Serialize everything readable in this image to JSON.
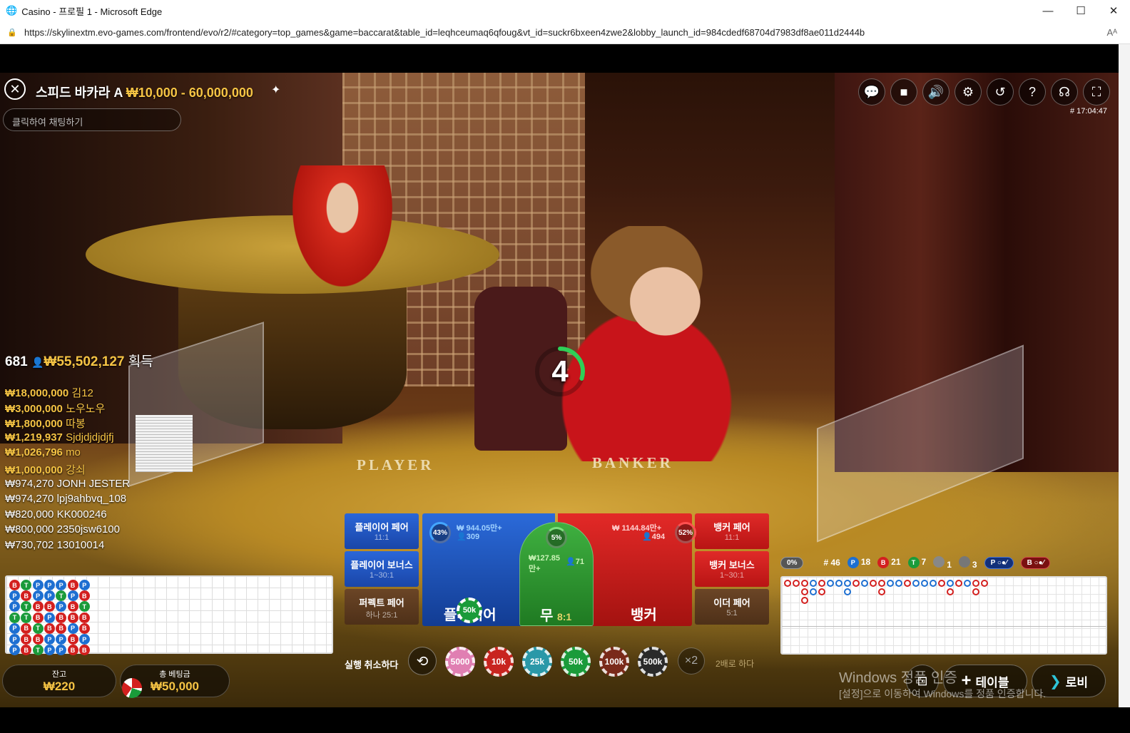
{
  "browser": {
    "title": "Casino - 프로필 1 - Microsoft Edge",
    "url": "https://skylinextm.evo-games.com/frontend/evo/r2/#category=top_games&game=baccarat&table_id=leqhceumaq6qfoug&vt_id=suckr6bxeen4zwe2&lobby_launch_id=984cdedf68704d7983df8ae011d2444b",
    "controls": {
      "minimize": "—",
      "maximize": "☐",
      "close": "✕"
    },
    "read_aloud": "Aᴬ"
  },
  "header": {
    "table_name": "스피드 바카라 A",
    "limits": "₩10,000 - 60,000,000",
    "chat_placeholder": "클릭하여 채팅하기",
    "game_id": "# 17:04:47",
    "icons": [
      "chat-icon",
      "video-icon",
      "volume-icon",
      "settings-icon",
      "history-icon",
      "help-icon",
      "headset-icon",
      "fullscreen-icon"
    ],
    "icon_glyphs": [
      "💬",
      "■",
      "🔊",
      "⚙",
      "↺",
      "?",
      "☊",
      "⛶"
    ]
  },
  "table_labels": {
    "player": "PLAYER",
    "banker": "BANKER"
  },
  "countdown": {
    "value": "4",
    "fraction_remaining": 0.3
  },
  "winners": {
    "count": "681",
    "total": "₩55,502,127",
    "label": "획득",
    "list": [
      {
        "amount": "₩18,000,000",
        "name": "김12"
      },
      {
        "amount": "₩3,000,000",
        "name": "노우노우"
      },
      {
        "amount": "₩1,800,000",
        "name": "따봉"
      },
      {
        "amount": "₩1,219,937",
        "name": "Sjdjdjdjdjfj"
      },
      {
        "amount": "₩1,026,796",
        "name": "mo"
      },
      {
        "amount": "₩1,000,000",
        "name": "강쇠"
      },
      {
        "amount": "₩974,270",
        "name": "JONH JESTER"
      },
      {
        "amount": "₩974,270",
        "name": "lpj9ahbvq_108"
      },
      {
        "amount": "₩820,000",
        "name": "KK000246"
      },
      {
        "amount": "₩800,000",
        "name": "2350jsw6100"
      },
      {
        "amount": "₩730,702",
        "name": "13010014"
      }
    ]
  },
  "bead_road": [
    [
      "B",
      "P",
      "P",
      "T",
      "P",
      "P",
      "P"
    ],
    [
      "T",
      "B",
      "T",
      "T",
      "B",
      "B",
      "B"
    ],
    [
      "P",
      "P",
      "B",
      "B",
      "T",
      "B",
      "T"
    ],
    [
      "P",
      "P",
      "B",
      "P",
      "B",
      "P",
      "P"
    ],
    [
      "P",
      "T",
      "P",
      "B",
      "B",
      "P",
      "P"
    ],
    [
      "B",
      "P",
      "B",
      "B",
      "P",
      "B",
      "B"
    ],
    [
      "P",
      "B",
      "T",
      "B",
      "B",
      "P",
      "B"
    ]
  ],
  "balance": {
    "label": "잔고",
    "value": "₩220"
  },
  "total_bet": {
    "label": "총 베팅금",
    "value": "₩50,000"
  },
  "bets": {
    "player_pair": {
      "label": "플레이어 페어",
      "odds": "11:1"
    },
    "player_bonus": {
      "label": "플레이어 보너스",
      "odds": "1~30:1"
    },
    "perfect_pair": {
      "label": "퍼펙트 페어",
      "odds": "하나 25:1"
    },
    "banker_pair": {
      "label": "뱅커 페어",
      "odds": "11:1"
    },
    "banker_bonus": {
      "label": "뱅커 보너스",
      "odds": "1~30:1"
    },
    "either_pair": {
      "label": "이더 페어",
      "odds": "5:1"
    },
    "player": {
      "label": "플레이어",
      "amount": "₩ 944.05만+",
      "players": "309",
      "percent": "43%",
      "chip": "50k"
    },
    "tie": {
      "label": "무",
      "odds": "8:1",
      "amount": "₩127.85만+",
      "players": "71",
      "percent": "5%"
    },
    "banker": {
      "label": "뱅커",
      "amount": "₩ 1144.84만+",
      "players": "494",
      "percent": "52%"
    }
  },
  "chip_tray": {
    "undo_label": "실행 취소하다",
    "undo_glyph": "⟲",
    "chips": [
      {
        "label": "5000",
        "color": "#e07fb2"
      },
      {
        "label": "10k",
        "color": "#c8241f"
      },
      {
        "label": "25k",
        "color": "#2a98a8"
      },
      {
        "label": "50k",
        "color": "#1a9b3a"
      },
      {
        "label": "100k",
        "color": "#7a2a1a"
      },
      {
        "label": "500k",
        "color": "#2a2a2a"
      }
    ],
    "double_glyph": "×2",
    "double_label": "2배로 하다"
  },
  "road_stats": {
    "progress": "0%",
    "round": "# 46",
    "p_count": "18",
    "b_count": "21",
    "t_count": "7",
    "pp_count": "1",
    "bp_count": "3",
    "p_badge": "P",
    "b_badge": "B",
    "t_badge": "T",
    "p_predict": "P ○●⁄",
    "b_predict": "B ○●⁄"
  },
  "bottom_buttons": {
    "table_glyph": "+",
    "table_label": "테이블",
    "lobby_glyph": "❯",
    "lobby_label": "로비"
  },
  "watermark": {
    "line1": "Windows 정품 인증",
    "line2": "[설정]으로 이동하여 Windows를 정품 인증합니다."
  }
}
